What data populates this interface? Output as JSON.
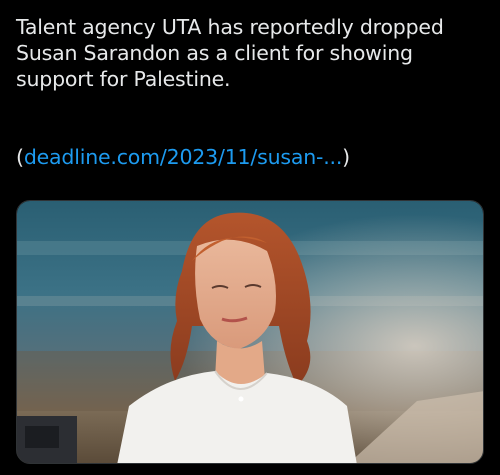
{
  "tweet": {
    "text": "Talent agency UTA has reportedly dropped Susan Sarandon as a client for showing support for Palestine.",
    "link_open": "(",
    "link_text": "deadline.com/2023/11/susan-...",
    "link_close": ")"
  },
  "media": {
    "icon": "photo"
  },
  "colors": {
    "background": "#000000",
    "text": "#e7e9ea",
    "link": "#1d9bf0"
  }
}
